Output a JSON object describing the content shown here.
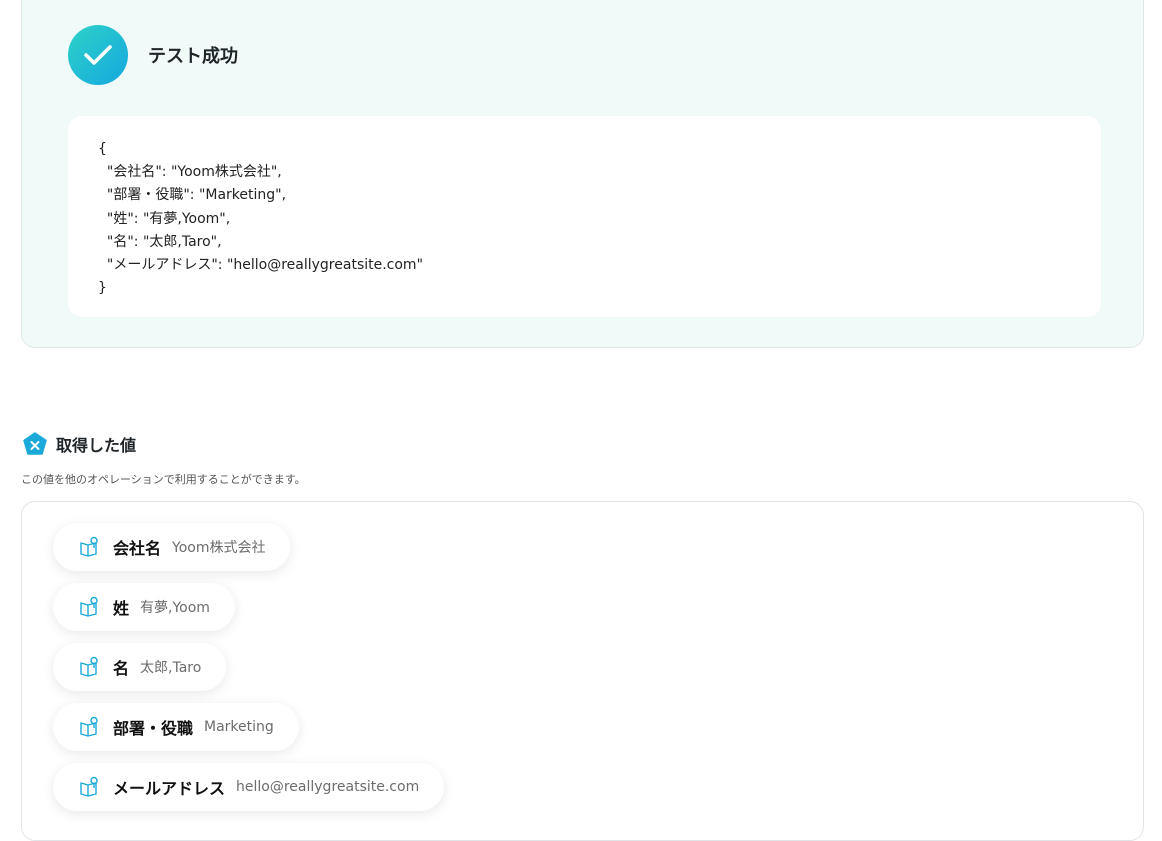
{
  "test_result": {
    "title": "テスト成功",
    "json_lines": [
      "{",
      "  \"会社名\": \"Yoom株式会社\",",
      "  \"部署・役職\": \"Marketing\",",
      "  \"姓\": \"有夢,Yoom\",",
      "  \"名\": \"太郎,Taro\",",
      "  \"メールアドレス\": \"hello@reallygreatsite.com\"",
      "}"
    ]
  },
  "acquired_values": {
    "title": "取得した値",
    "description": "この値を他のオペレーションで利用することができます。",
    "items": [
      {
        "key": "会社名",
        "value": "Yoom株式会社"
      },
      {
        "key": "姓",
        "value": "有夢,Yoom"
      },
      {
        "key": "名",
        "value": "太郎,Taro"
      },
      {
        "key": "部署・役職",
        "value": "Marketing"
      },
      {
        "key": "メールアドレス",
        "value": "hello@reallygreatsite.com"
      }
    ]
  },
  "colors": {
    "panel_bg": "#f0faf8",
    "check_gradient_start": "#2ed3c8",
    "check_gradient_end": "#15a7df",
    "icon_accent": "#1aa9d8"
  },
  "icons": {
    "success": "check-circle-icon",
    "section": "variable-pentagon-icon",
    "chip": "book-icon"
  }
}
